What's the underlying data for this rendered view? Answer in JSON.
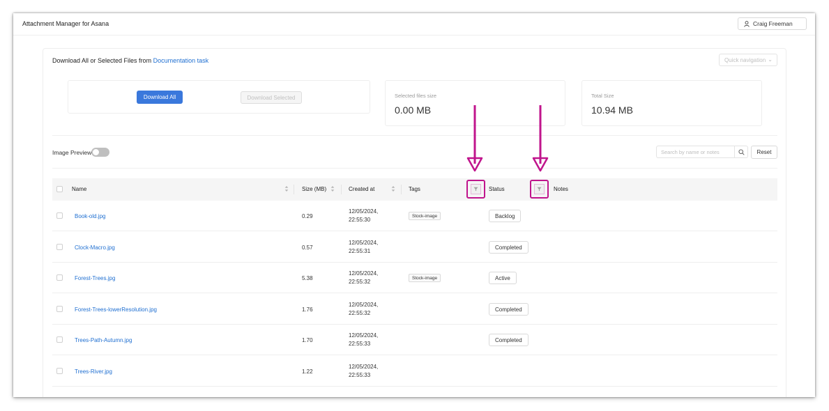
{
  "app": {
    "title": "Attachment Manager for Asana"
  },
  "user": {
    "name": "Craig Freeman",
    "more_label": "···"
  },
  "header": {
    "prefix": "Download All or Selected Files from",
    "task_link": "Documentation task",
    "quick_nav_placeholder": "Quick navigation"
  },
  "actions": {
    "download_all": "Download All",
    "download_selected": "Download Selected"
  },
  "stats": {
    "selected_label": "Selected files size",
    "selected_value": "0.00 MB",
    "total_label": "Total Size",
    "total_value": "10.94 MB"
  },
  "toolbar": {
    "image_preview_label": "Image Preview",
    "image_preview_on": false,
    "search_placeholder": "Search by name or notes",
    "reset_label": "Reset"
  },
  "table": {
    "columns": {
      "name": "Name",
      "size": "Size (MB)",
      "created": "Created at",
      "tags": "Tags",
      "status": "Status",
      "notes": "Notes"
    },
    "rows": [
      {
        "name": "Book-old.jpg",
        "size": "0.29",
        "created_date": "12/05/2024,",
        "created_time": "22:55:30",
        "tag": "Stock-image",
        "status": "Backlog"
      },
      {
        "name": "Clock-Macro.jpg",
        "size": "0.57",
        "created_date": "12/05/2024,",
        "created_time": "22:55:31",
        "tag": "",
        "status": "Completed"
      },
      {
        "name": "Forest-Trees.jpg",
        "size": "5.38",
        "created_date": "12/05/2024,",
        "created_time": "22:55:32",
        "tag": "Stock-image",
        "status": "Active"
      },
      {
        "name": "Forest-Trees-lowerResolution.jpg",
        "size": "1.76",
        "created_date": "12/05/2024,",
        "created_time": "22:55:32",
        "tag": "",
        "status": "Completed"
      },
      {
        "name": "Trees-Path-Autumn.jpg",
        "size": "1.70",
        "created_date": "12/05/2024,",
        "created_time": "22:55:33",
        "tag": "",
        "status": "Completed"
      },
      {
        "name": "Trees-River.jpg",
        "size": "1.22",
        "created_date": "12/05/2024,",
        "created_time": "22:55:33",
        "tag": "",
        "status": ""
      }
    ]
  },
  "annotation": {
    "highlight_color": "#c0148c"
  }
}
